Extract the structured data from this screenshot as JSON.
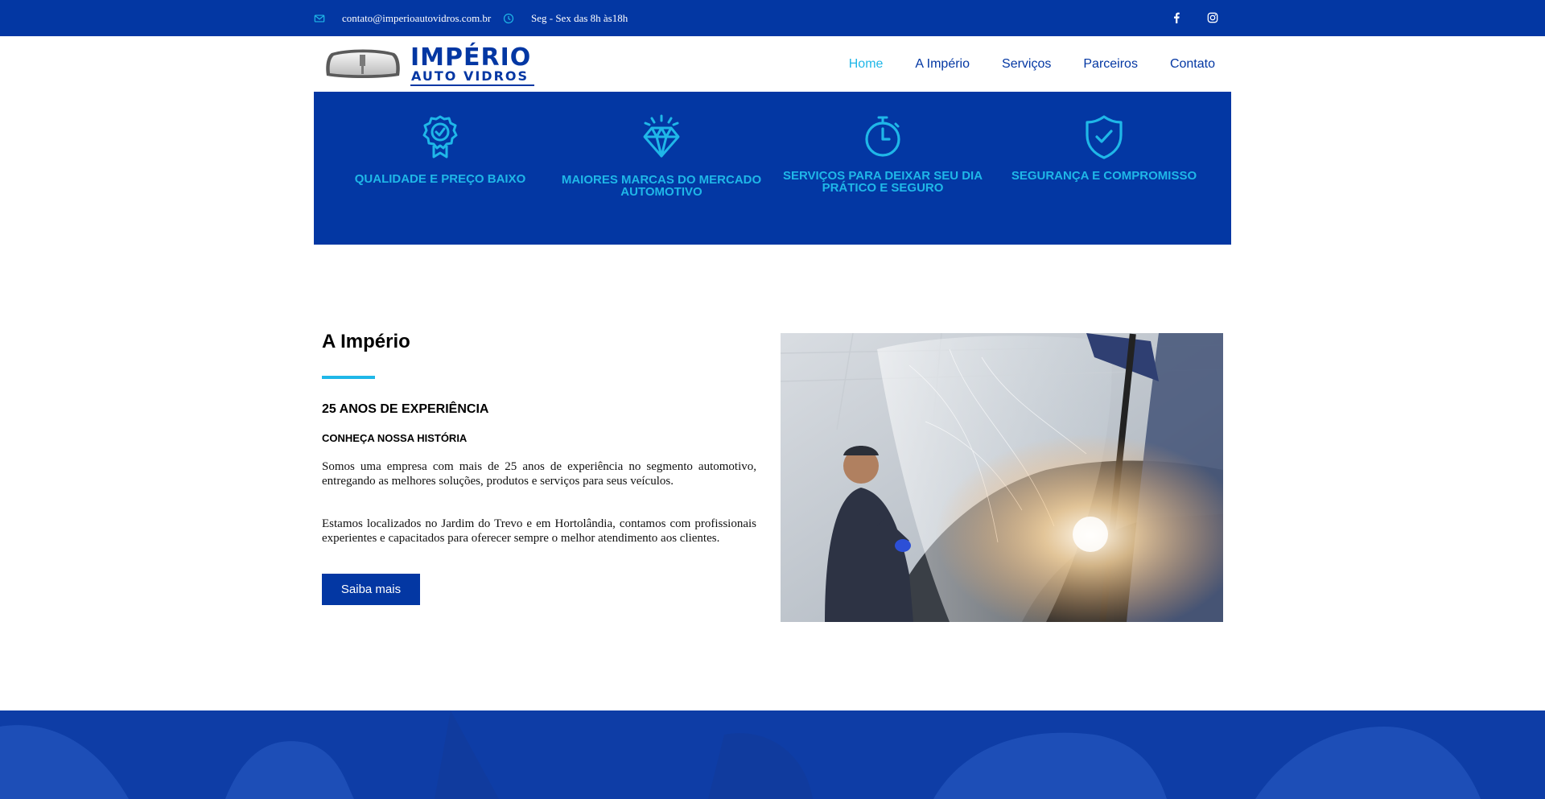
{
  "topbar": {
    "email": "contato@imperioautovidros.com.br",
    "hours": "Seg - Sex das 8h às18h",
    "icons": [
      "envelope-icon",
      "clock-icon",
      "facebook-icon",
      "instagram-icon"
    ]
  },
  "logo": {
    "title": "IMPÉRIO",
    "subtitle": "AUTO VIDROS"
  },
  "nav": {
    "items": [
      {
        "label": "Home",
        "active": true
      },
      {
        "label": "A Império",
        "active": false
      },
      {
        "label": "Serviços",
        "active": false
      },
      {
        "label": "Parceiros",
        "active": false
      },
      {
        "label": "Contato",
        "active": false
      }
    ]
  },
  "features": [
    {
      "icon": "award-badge-icon",
      "text": "QUALIDADE E PREÇO BAIXO"
    },
    {
      "icon": "diamond-icon",
      "text": "MAIORES MARCAS DO MERCADO AUTOMOTIVO"
    },
    {
      "icon": "stopwatch-icon",
      "text": "SERVIÇOS PARA DEIXAR SEU DIA PRÁTICO E SEGURO"
    },
    {
      "icon": "shield-check-icon",
      "text": "SEGURANÇA E COMPROMISSO"
    }
  ],
  "about": {
    "title": "A Império",
    "subtitle": "25 ANOS DE EXPERIÊNCIA",
    "kicker": "CONHEÇA NOSSA HISTÓRIA",
    "paragraph1": "Somos uma empresa com mais de 25 anos de experiência no segmento automotivo, entregando as melhores soluções, produtos e serviços para seus veículos.",
    "paragraph2": "Estamos localizados no Jardim do Trevo e em Hortolândia, contamos com profissionais experientes e capacitados para oferecer sempre o melhor atendimento aos clientes.",
    "button": "Saiba mais"
  },
  "colors": {
    "brand_blue": "#0337a3",
    "accent_cyan": "#1fb7e8",
    "white": "#ffffff"
  }
}
